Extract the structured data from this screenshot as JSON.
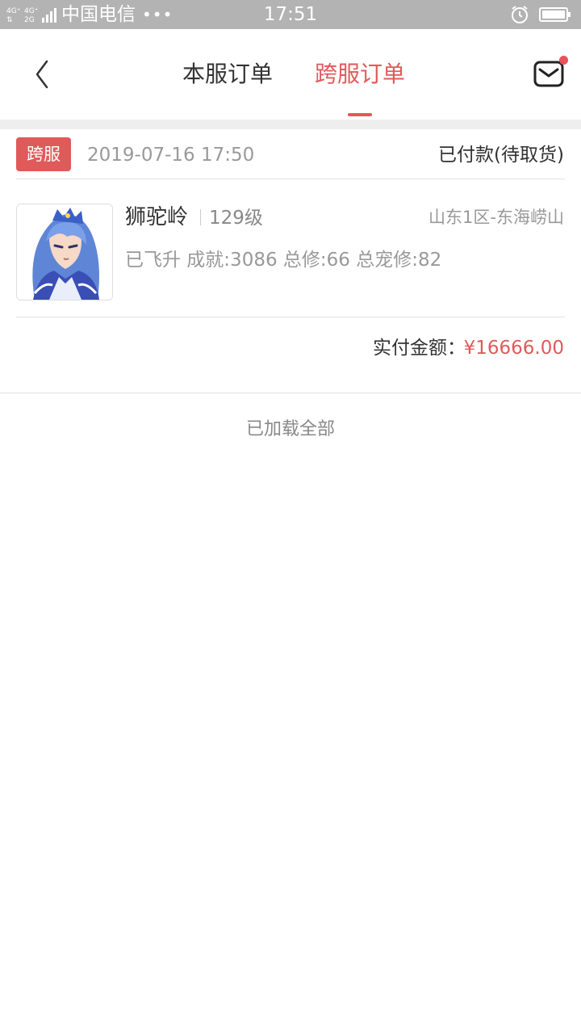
{
  "status_bar": {
    "network_top": "4G⁺ 4G⁺",
    "network_bottom": "2G",
    "carrier": "中国电信",
    "more": "•••",
    "time": "17:51",
    "alarm_icon": "alarm-clock-icon",
    "battery_icon": "battery-icon"
  },
  "header": {
    "back_icon": "chevron-left-icon",
    "tabs": [
      {
        "label": "本服订单",
        "active": false
      },
      {
        "label": "跨服订单",
        "active": true
      }
    ],
    "mail_icon": "mail-icon",
    "has_unread": true
  },
  "order": {
    "badge": "跨服",
    "time": "2019-07-16 17:50",
    "status": "已付款(待取货)",
    "character": {
      "name": "狮驼岭",
      "level": "129级",
      "server": "山东1区-东海崂山",
      "stats": "已飞升 成就:3086 总修:66 总宠修:82",
      "avatar_icon": "character-portrait"
    },
    "pay_label": "实付金额：",
    "pay_amount": "¥16666.00"
  },
  "footer": {
    "loaded_all": "已加载全部"
  },
  "colors": {
    "accent": "#e05a5a",
    "status_bar": "#b3b3b3",
    "text_primary": "#333333",
    "text_secondary": "#999999"
  }
}
